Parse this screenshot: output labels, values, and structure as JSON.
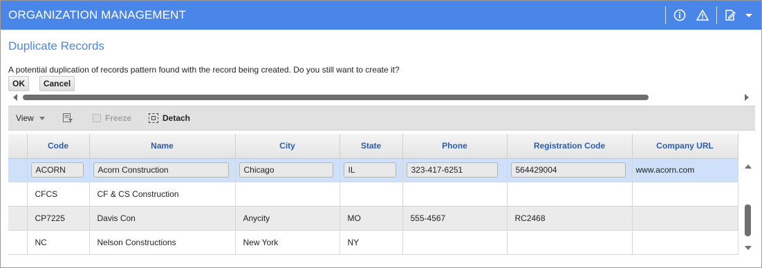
{
  "header": {
    "title": "ORGANIZATION MANAGEMENT",
    "icons": [
      "info-icon",
      "warning-icon",
      "edit-note-icon",
      "dropdown-arrow-icon"
    ],
    "background": "#4a86e8"
  },
  "dialog": {
    "title": "Duplicate Records",
    "message": "A potential duplication of records pattern found with the record being created. Do you still want to create it?",
    "ok_label": "OK",
    "cancel_label": "Cancel"
  },
  "toolbar": {
    "view_label": "View",
    "freeze_label": "Freeze",
    "detach_label": "Detach"
  },
  "table": {
    "columns": [
      "Code",
      "Name",
      "City",
      "State",
      "Phone",
      "Registration Code",
      "Company URL"
    ],
    "rows": [
      [
        "ACORN",
        "Acorn Construction",
        "Chicago",
        "IL",
        "323-417-6251",
        "564429004",
        "www.acorn.com"
      ],
      [
        "CFCS",
        "CF & CS Construction",
        "",
        "",
        "",
        "",
        ""
      ],
      [
        "CP7225",
        "Davis Con",
        "Anycity",
        "MO",
        "555-4567",
        "RC2468",
        ""
      ],
      [
        "NC",
        "Nelson Constructions",
        "New York",
        "NY",
        "",
        "",
        ""
      ]
    ],
    "selected_row": 0
  },
  "colors": {
    "accent": "#4a86e8",
    "header_text": "#2a5db0",
    "selected_row": "#cfe0fb"
  }
}
